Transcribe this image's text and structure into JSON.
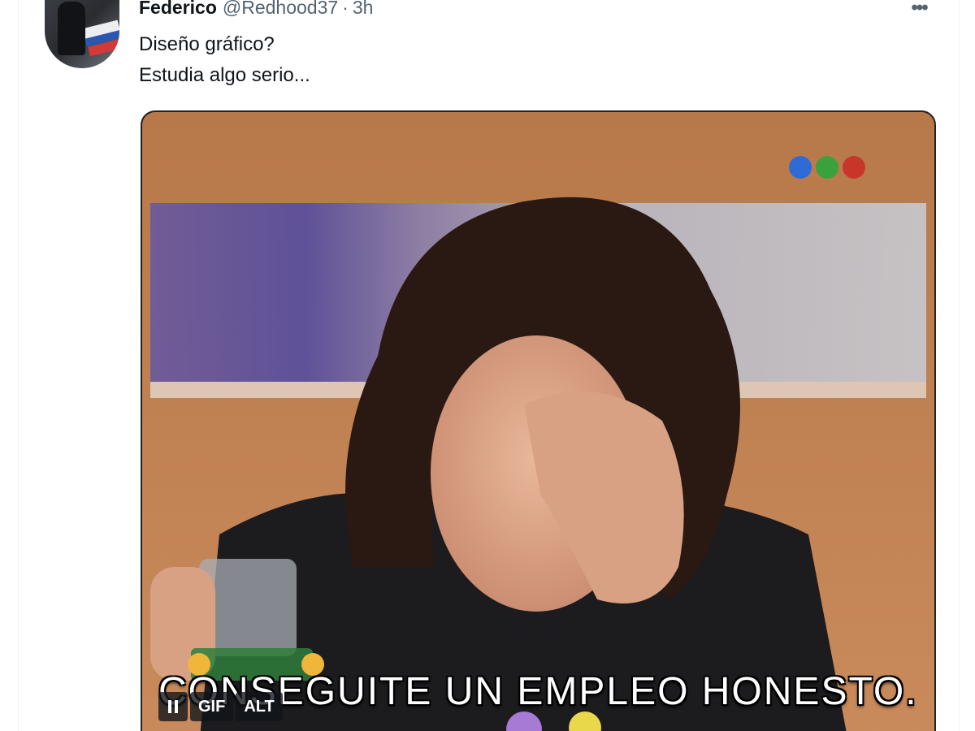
{
  "tweet": {
    "display_name": "Federico",
    "handle": "@Redhood37",
    "separator": "·",
    "timestamp": "3h",
    "more_icon": "more-horizontal-icon",
    "lines": [
      "Diseño gráfico?",
      "Estudia algo serio..."
    ]
  },
  "media": {
    "type": "gif",
    "subtitle": "CONSEGUITE UN EMPLEO HONESTO.",
    "controls": {
      "pause_icon": "pause-icon",
      "gif_label": "GIF",
      "alt_label": "ALT"
    },
    "channel_logo_colors": [
      "#2e6bd6",
      "#3aa23c",
      "#c8362a"
    ]
  },
  "colors": {
    "text_primary": "#0f1419",
    "text_secondary": "#536471",
    "divider": "#eff3f4"
  }
}
